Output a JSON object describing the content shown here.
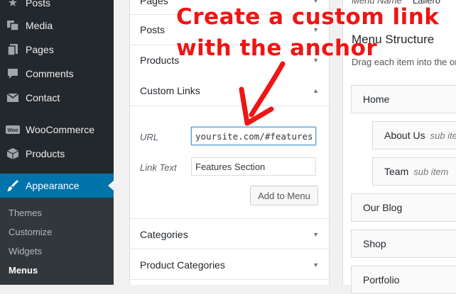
{
  "sidebar": {
    "items": [
      {
        "label": "Posts",
        "icon": "pushpin-icon"
      },
      {
        "label": "Media",
        "icon": "media-icon"
      },
      {
        "label": "Pages",
        "icon": "pages-icon"
      },
      {
        "label": "Comments",
        "icon": "comments-icon"
      },
      {
        "label": "Contact",
        "icon": "mail-icon"
      },
      {
        "label": "WooCommerce",
        "icon": "woocommerce-icon"
      },
      {
        "label": "Products",
        "icon": "box-icon"
      },
      {
        "label": "Appearance",
        "icon": "paintbrush-icon"
      }
    ],
    "submenu": [
      "Themes",
      "Customize",
      "Widgets",
      "Menus"
    ]
  },
  "accordion": {
    "sections": [
      "Pages",
      "Posts",
      "Products",
      "Custom Links",
      "Categories",
      "Product Categories"
    ],
    "url_label": "URL",
    "url_value": "yoursite.com/#features",
    "link_text_label": "Link Text",
    "link_text_value": "Features Section",
    "add_button": "Add to Menu"
  },
  "right": {
    "menu_name_label": "Menu Name",
    "menu_name_value": "Lallero",
    "title": "Menu Structure",
    "description": "Drag each item into the or",
    "items": [
      {
        "label": "Home",
        "sub": ""
      },
      {
        "label": "About Us",
        "sub": "sub item"
      },
      {
        "label": "Team",
        "sub": "sub item"
      },
      {
        "label": "Our Blog",
        "sub": ""
      },
      {
        "label": "Shop",
        "sub": ""
      },
      {
        "label": "Portfolio",
        "sub": ""
      }
    ]
  },
  "annotation": {
    "line1": "Create a custom link",
    "line2": "with the anchor",
    "color": "#ee1515"
  }
}
